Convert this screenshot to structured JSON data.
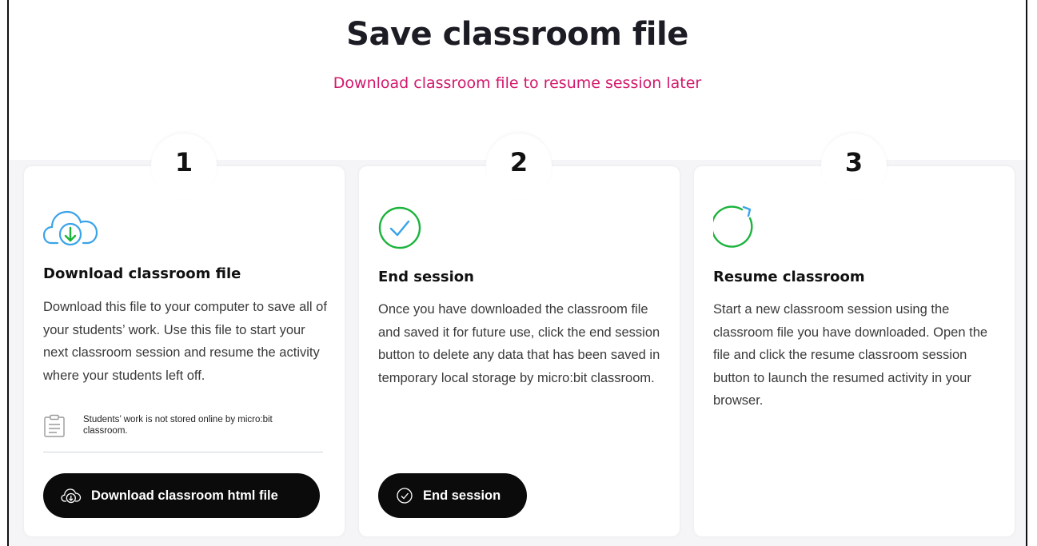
{
  "header": {
    "title": "Save classroom file",
    "subtitle": "Download classroom file to resume session later"
  },
  "colors": {
    "accent_pink": "#d3186b",
    "icon_blue": "#3aa3e8",
    "icon_green": "#1ab33b",
    "button_bg": "#0b0b0b"
  },
  "steps": [
    {
      "number": "1",
      "icon": "cloud-download-icon",
      "title": "Download classroom file",
      "text": "Download this file to your computer to save all of your students’ work. Use this file to start your next classroom session and resume the activity where your students left off.",
      "note": {
        "icon": "notepad-icon",
        "text": "Students’ work is not stored online by micro:bit classroom."
      },
      "button": {
        "label": "Download classroom html file",
        "icon": "cloud-download-icon"
      }
    },
    {
      "number": "2",
      "icon": "check-circle-icon",
      "title": "End session",
      "text": "Once you have downloaded the classroom file and saved it for future use, click the end session button to delete any data that has been saved in temporary local storage by micro:bit classroom.",
      "button": {
        "label": "End session",
        "icon": "check-circle-icon"
      }
    },
    {
      "number": "3",
      "icon": "refresh-circle-icon",
      "title": "Resume classroom",
      "text": "Start a new classroom session using the classroom file you have downloaded. Open the file and click the resume classroom session button to launch the resumed activity in your browser."
    }
  ]
}
